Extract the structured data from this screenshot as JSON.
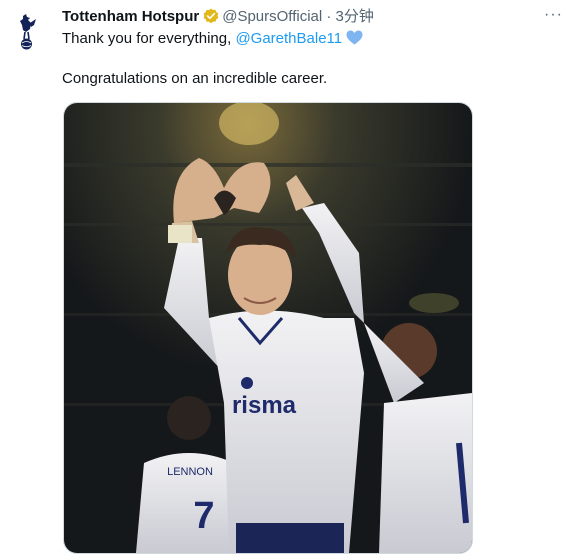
{
  "tweet": {
    "author_name": "Tottenham Hotspur",
    "handle": "@SpursOfficial",
    "separator": "·",
    "time": "3分钟",
    "text_line1": "Thank you for everything, ",
    "mention": "@GarethBale11",
    "text_line2": "Congratulations on an incredible career.",
    "more_label": "···"
  },
  "media": {
    "shirt_sponsor": "risma",
    "back_number": "7",
    "back_name": "LENNON"
  },
  "colors": {
    "link": "#1d9bf0",
    "verified_badge": "#e2b719",
    "heart": "#7eb4f0",
    "crest_navy": "#132257"
  },
  "icons": {
    "avatar": "spurs-crest-icon",
    "verified": "verified-badge-icon",
    "heart": "blue-heart-icon",
    "more": "more-options-icon"
  }
}
